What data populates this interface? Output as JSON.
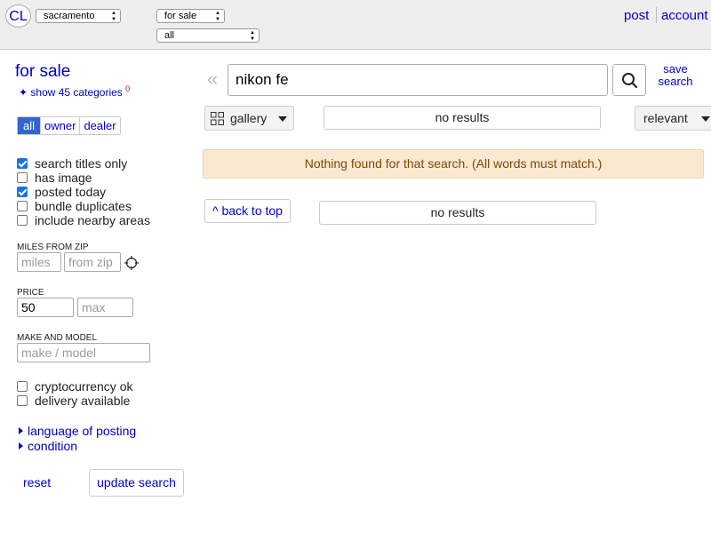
{
  "header": {
    "logo": "CL",
    "location": "sacramento",
    "category": "for sale",
    "subcategory": "all",
    "post": "post",
    "account": "account"
  },
  "sidebar": {
    "title": "for sale",
    "show_categories": "show 45 categories",
    "show_categories_count": "0",
    "seller_types": [
      "all",
      "owner",
      "dealer"
    ],
    "seller_selected": "all",
    "options": [
      {
        "label": "search titles only",
        "checked": true
      },
      {
        "label": "has image",
        "checked": false
      },
      {
        "label": "posted today",
        "checked": true
      },
      {
        "label": "bundle duplicates",
        "checked": false
      },
      {
        "label": "include nearby areas",
        "checked": false
      }
    ],
    "miles_label": "MILES FROM ZIP",
    "miles_placeholder": "miles",
    "zip_placeholder": "from zip",
    "price_label": "PRICE",
    "price_min": "50",
    "price_max_placeholder": "max",
    "make_label": "MAKE AND MODEL",
    "make_placeholder": "make / model",
    "extra_options": [
      {
        "label": "cryptocurrency ok",
        "checked": false
      },
      {
        "label": "delivery available",
        "checked": false
      }
    ],
    "expanders": [
      "language of posting",
      "condition"
    ],
    "reset": "reset",
    "update": "update search"
  },
  "main": {
    "query": "nikon fe",
    "save_search": "save search",
    "view_mode": "gallery",
    "results_top": "no results",
    "sort": "relevant",
    "notice": "Nothing found for that search. (All words must match.)",
    "back_to_top": "^ back to top",
    "results_bottom": "no results"
  },
  "colors": {
    "link": "#0000cc",
    "header_bg": "#eeeeee",
    "checkbox_checked": "#1a73e8",
    "notice_bg": "#fbe8d2",
    "notice_text": "#7a4a00",
    "seller_active": "#3366cc"
  }
}
